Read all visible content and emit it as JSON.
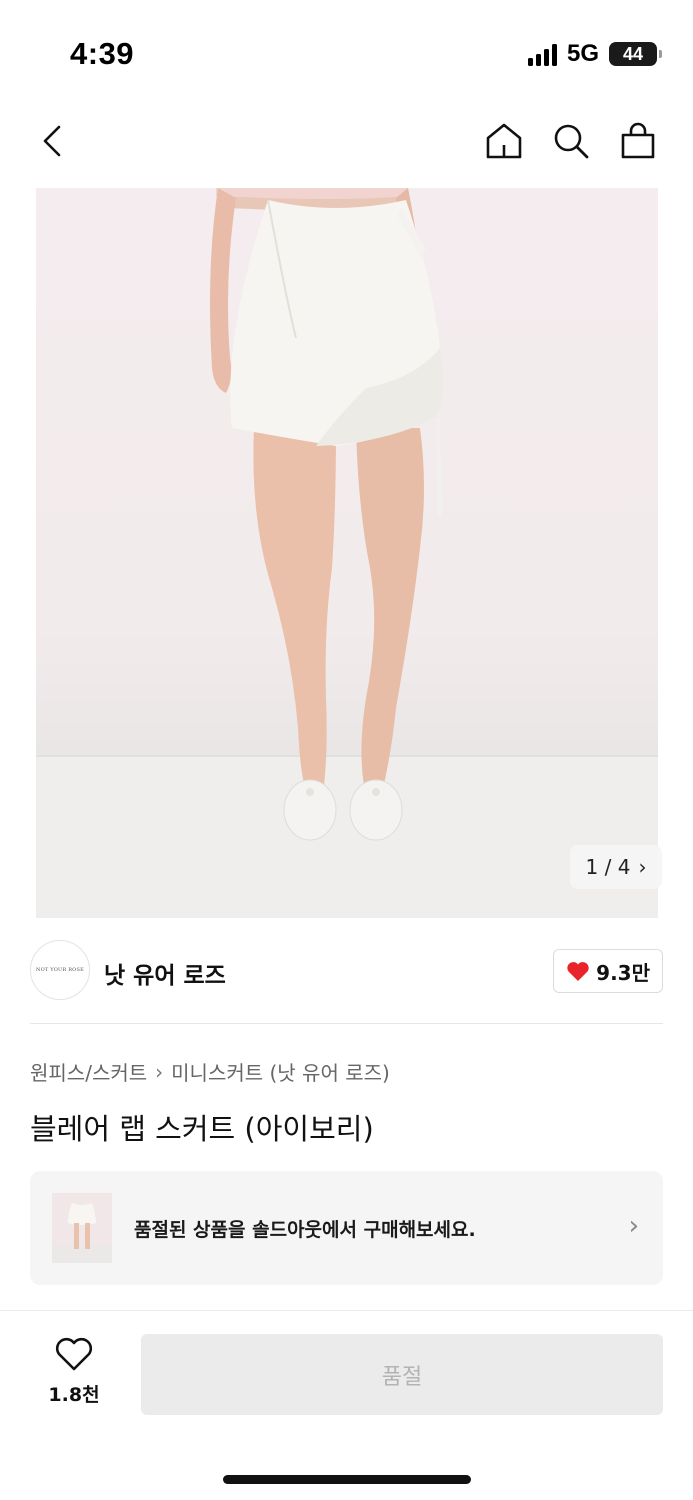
{
  "status_bar": {
    "time": "4:39",
    "network": "5G",
    "battery": "44"
  },
  "nav": {
    "icons": [
      "back-icon",
      "home-icon",
      "search-icon",
      "bag-icon"
    ]
  },
  "gallery": {
    "counter": "1 / 4",
    "current": 1,
    "total": 4
  },
  "store": {
    "logo_text": "NOT YOUR ROSE",
    "name": "낫 유어 로즈",
    "likes": "9.3만",
    "heart_color": "#e8232a"
  },
  "breadcrumb": {
    "category": "원피스/스커트",
    "subcategory": "미니스커트 (낫 유어 로즈)"
  },
  "product": {
    "title": "블레어 랩 스커트 (아이보리)"
  },
  "soldout_banner": {
    "text": "품절된 상품을 솔드아웃에서 구매해보세요."
  },
  "bottom_bar": {
    "wish_count": "1.8천",
    "button_label": "품절"
  }
}
